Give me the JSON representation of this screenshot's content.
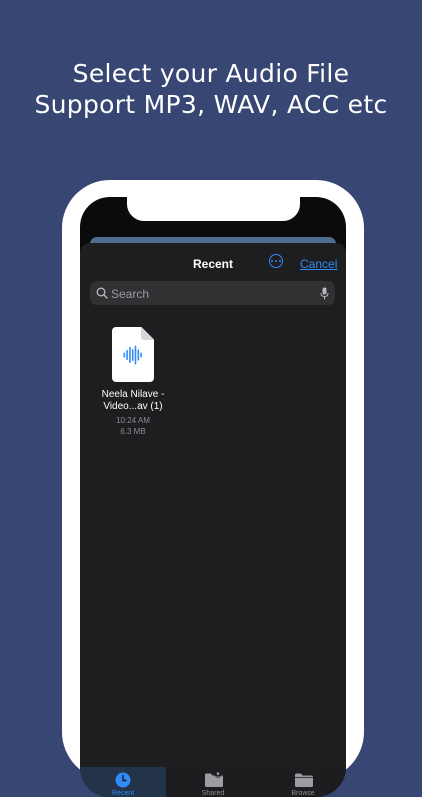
{
  "headline": {
    "line1": "Select your Audio File",
    "line2": "Support MP3, WAV, ACC etc"
  },
  "picker": {
    "title": "Recent",
    "cancel_label": "Cancel",
    "more_icon": "ellipsis-circle-icon",
    "search": {
      "placeholder": "Search",
      "icon": "search-icon",
      "mic_icon": "microphone-icon"
    },
    "files": [
      {
        "name_line1": "Neela Nilave -",
        "name_line2": "Video...av (1)",
        "time": "10:24 AM",
        "size": "6.3 MB",
        "icon": "audio-file-icon"
      }
    ],
    "tabs": [
      {
        "label": "Recent",
        "icon": "clock-icon",
        "active": true
      },
      {
        "label": "Shared",
        "icon": "shared-folder-icon",
        "active": false
      },
      {
        "label": "Browse",
        "icon": "folder-icon",
        "active": false
      }
    ]
  },
  "colors": {
    "background": "#374672",
    "accent": "#2f8cf7",
    "sheet": "#1e1e20"
  }
}
